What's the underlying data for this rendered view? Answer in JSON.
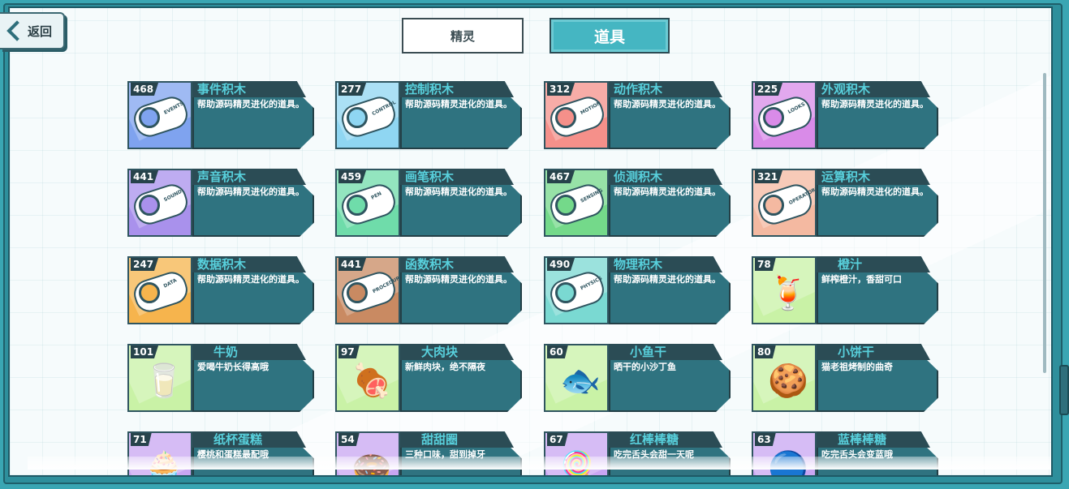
{
  "nav": {
    "back_label": "返回"
  },
  "tabs": [
    {
      "label": "精灵",
      "active": false
    },
    {
      "label": "道具",
      "active": true
    }
  ],
  "desc_common": "帮助源码精灵进化的道具。",
  "items": [
    {
      "count": "468",
      "title": "事件积木",
      "desc": "帮助源码精灵进化的道具。",
      "tag": "EVENTS",
      "color": "#7fa3ef",
      "icon": "toggle-icon"
    },
    {
      "count": "277",
      "title": "控制积木",
      "desc": "帮助源码精灵进化的道具。",
      "tag": "CONTROL",
      "color": "#8fd6f2",
      "icon": "gamepad-icon"
    },
    {
      "count": "312",
      "title": "动作积木",
      "desc": "帮助源码精灵进化的道具。",
      "tag": "MOTION",
      "color": "#f5908a",
      "icon": "ghost-icon"
    },
    {
      "count": "225",
      "title": "外观积木",
      "desc": "帮助源码精灵进化的道具。",
      "tag": "LOOKS",
      "color": "#d98be8",
      "icon": "shirt-icon"
    },
    {
      "count": "441",
      "title": "声音积木",
      "desc": "帮助源码精灵进化的道具。",
      "tag": "SOUND",
      "color": "#a991ec",
      "icon": "microphone-icon"
    },
    {
      "count": "459",
      "title": "画笔积木",
      "desc": "帮助源码精灵进化的道具。",
      "tag": "PEN",
      "color": "#6fdcaa",
      "icon": "pen-icon"
    },
    {
      "count": "467",
      "title": "侦测积木",
      "desc": "帮助源码精灵进化的道具。",
      "tag": "SENSING",
      "color": "#74d98a",
      "icon": "target-icon"
    },
    {
      "count": "321",
      "title": "运算积木",
      "desc": "帮助源码精灵进化的道具。",
      "tag": "OPERATORS",
      "color": "#f4b9a1",
      "icon": "calculator-icon"
    },
    {
      "count": "247",
      "title": "数据积木",
      "desc": "帮助源码精灵进化的道具。",
      "tag": "DATA",
      "color": "#f6b44d",
      "icon": "chart-icon"
    },
    {
      "count": "441",
      "title": "函数积木",
      "desc": "帮助源码精灵进化的道具。",
      "tag": "PROCEDURES",
      "color": "#c98a62",
      "icon": "function-icon"
    },
    {
      "count": "490",
      "title": "物理积木",
      "desc": "帮助源码精灵进化的道具。",
      "tag": "PHYSICS",
      "color": "#7ad9d2",
      "icon": "magnet-icon"
    },
    {
      "count": "78",
      "title": "橙汁",
      "desc": "鲜榨橙汁，香甜可口",
      "color": "#c9f2a6",
      "icon": "orange-juice-icon",
      "glyph": "🍹"
    },
    {
      "count": "101",
      "title": "牛奶",
      "desc": "爱喝牛奶长得高哦",
      "color": "#c9f2a6",
      "icon": "milk-carton-icon",
      "glyph": "🥛"
    },
    {
      "count": "97",
      "title": "大肉块",
      "desc": "新鲜肉块，绝不隔夜",
      "color": "#c9f2a6",
      "icon": "meat-icon",
      "glyph": "🍖"
    },
    {
      "count": "60",
      "title": "小鱼干",
      "desc": "晒干的小沙丁鱼",
      "color": "#c9f2a6",
      "icon": "dried-fish-icon",
      "glyph": "🐟"
    },
    {
      "count": "80",
      "title": "小饼干",
      "desc": "猫老祖烤制的曲奇",
      "color": "#c9f2a6",
      "icon": "cookie-icon",
      "glyph": "🍪"
    },
    {
      "count": "71",
      "title": "纸杯蛋糕",
      "desc": "樱桃和蛋糕最配哦",
      "color": "#c9a6f2",
      "icon": "cupcake-icon",
      "glyph": "🧁"
    },
    {
      "count": "54",
      "title": "甜甜圈",
      "desc": "三种口味，甜到掉牙",
      "color": "#c9a6f2",
      "icon": "donut-icon",
      "glyph": "🍩"
    },
    {
      "count": "67",
      "title": "红棒棒糖",
      "desc": "吃完舌头会甜一天呢",
      "color": "#c9a6f2",
      "icon": "red-lollipop-icon",
      "glyph": "🍭"
    },
    {
      "count": "63",
      "title": "蓝棒棒糖",
      "desc": "吃完舌头会变蓝哦",
      "color": "#c9a6f2",
      "icon": "blue-lollipop-icon",
      "glyph": "🔵"
    }
  ]
}
